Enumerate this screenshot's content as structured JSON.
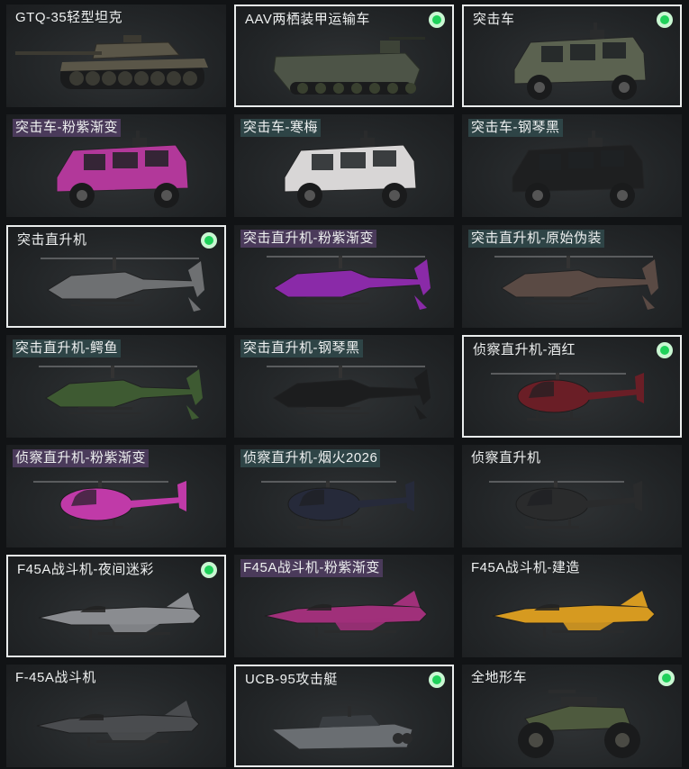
{
  "cards": [
    {
      "label": "GTQ-35轻型坦克",
      "icon": "tank-icon",
      "owned": false,
      "selected": false,
      "tag": "none",
      "color": "#5a5648"
    },
    {
      "label": "AAV两栖装甲运输车",
      "icon": "amphibious-vehicle-icon",
      "owned": true,
      "selected": true,
      "tag": "none",
      "color": "#4d5447"
    },
    {
      "label": "突击车",
      "icon": "armored-car-icon",
      "owned": true,
      "selected": true,
      "tag": "none",
      "color": "#5b6250"
    },
    {
      "label": "突击车-粉紫渐变",
      "icon": "armored-car-icon",
      "owned": false,
      "selected": false,
      "tag": "purple",
      "color": "#b2389a"
    },
    {
      "label": "突击车-寒梅",
      "icon": "armored-car-icon",
      "owned": false,
      "selected": false,
      "tag": "teal",
      "color": "#d8d6d6"
    },
    {
      "label": "突击车-钢琴黑",
      "icon": "armored-car-icon",
      "owned": false,
      "selected": false,
      "tag": "teal",
      "color": "#1e1f20"
    },
    {
      "label": "突击直升机",
      "icon": "attack-helicopter-icon",
      "owned": true,
      "selected": true,
      "tag": "none",
      "color": "#6e7072"
    },
    {
      "label": "突击直升机-粉紫渐变",
      "icon": "attack-helicopter-icon",
      "owned": false,
      "selected": false,
      "tag": "purple",
      "color": "#8a2aa8"
    },
    {
      "label": "突击直升机-原始伪装",
      "icon": "attack-helicopter-icon",
      "owned": false,
      "selected": false,
      "tag": "teal",
      "color": "#5a4a44"
    },
    {
      "label": "突击直升机-鳄鱼",
      "icon": "attack-helicopter-icon",
      "owned": false,
      "selected": false,
      "tag": "teal",
      "color": "#3e5a32"
    },
    {
      "label": "突击直升机-钢琴黑",
      "icon": "attack-helicopter-icon",
      "owned": false,
      "selected": false,
      "tag": "teal",
      "color": "#1c1d1e"
    },
    {
      "label": "侦察直升机-酒红",
      "icon": "scout-helicopter-icon",
      "owned": true,
      "selected": true,
      "tag": "none",
      "color": "#6a1e26"
    },
    {
      "label": "侦察直升机-粉紫渐变",
      "icon": "scout-helicopter-icon",
      "owned": false,
      "selected": false,
      "tag": "purple",
      "color": "#c03aa8"
    },
    {
      "label": "侦察直升机-烟火2026",
      "icon": "scout-helicopter-icon",
      "owned": false,
      "selected": false,
      "tag": "teal",
      "color": "#262a3a"
    },
    {
      "label": "侦察直升机",
      "icon": "scout-helicopter-icon",
      "owned": false,
      "selected": false,
      "tag": "none",
      "color": "#2a2b2c"
    },
    {
      "label": "F45A战斗机-夜间迷彩",
      "icon": "fighter-jet-icon",
      "owned": true,
      "selected": true,
      "tag": "none",
      "color": "#8a8c90"
    },
    {
      "label": "F45A战斗机-粉紫渐变",
      "icon": "fighter-jet-icon",
      "owned": false,
      "selected": false,
      "tag": "purple",
      "color": "#a0307a"
    },
    {
      "label": "F45A战斗机-建造",
      "icon": "fighter-jet-icon",
      "owned": false,
      "selected": false,
      "tag": "none",
      "color": "#d69a20"
    },
    {
      "label": "F-45A战斗机",
      "icon": "fighter-jet-icon",
      "owned": false,
      "selected": false,
      "tag": "none",
      "color": "#4a4c4f"
    },
    {
      "label": "UCB-95攻击艇",
      "icon": "attack-boat-icon",
      "owned": true,
      "selected": true,
      "tag": "none",
      "color": "#6a6e72"
    },
    {
      "label": "全地形车",
      "icon": "atv-icon",
      "owned": true,
      "selected": false,
      "tag": "none",
      "color": "#4e5a3e"
    }
  ]
}
